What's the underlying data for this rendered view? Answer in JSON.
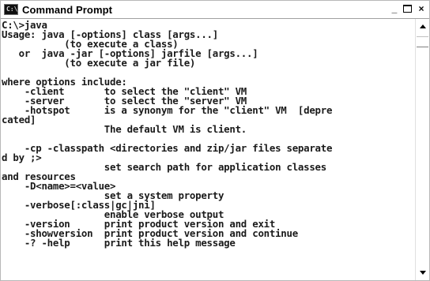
{
  "window": {
    "title": "Command Prompt",
    "icon_name": "command-prompt-icon",
    "controls": {
      "minimize": "_",
      "close": "×"
    }
  },
  "console": {
    "lines": [
      "C:\\>java",
      "Usage: java [-options] class [args...]",
      "           (to execute a class)",
      "   or  java -jar [-options] jarfile [args...]",
      "           (to execute a jar file)",
      "",
      "where options include:",
      "    -client       to select the \"client\" VM",
      "    -server       to select the \"server\" VM",
      "    -hotspot      is a synonym for the \"client\" VM  [depre",
      "cated]",
      "                  The default VM is client.",
      "",
      "    -cp -classpath <directories and zip/jar files separate",
      "d by ;>",
      "                  set search path for application classes",
      "and resources",
      "    -D<name>=<value>",
      "                  set a system property",
      "    -verbose[:class|gc|jni]",
      "                  enable verbose output",
      "    -version      print product version and exit",
      "    -showversion  print product version and continue",
      "    -? -help      print this help message"
    ]
  }
}
